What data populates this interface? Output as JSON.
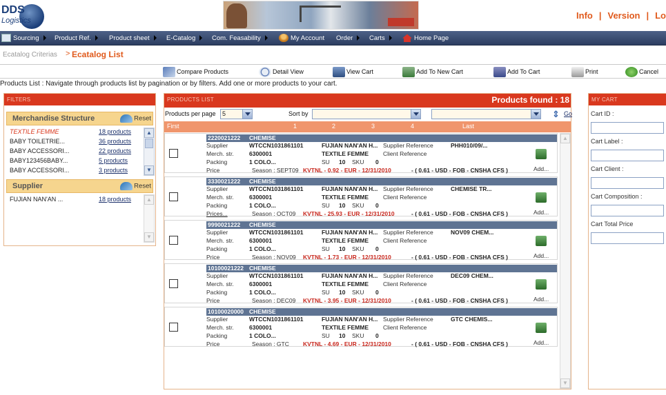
{
  "header": {
    "logo_text": "DDS",
    "logo_sub": "Logistics",
    "links": [
      "Info",
      "Version",
      "Lo"
    ],
    "separator": "|"
  },
  "menu": [
    {
      "label": "Sourcing",
      "icon": "sourcing-icon"
    },
    {
      "label": "Product Ref."
    },
    {
      "label": "Product sheet"
    },
    {
      "label": "E-Catalog"
    },
    {
      "label": "Com. Feasability"
    },
    {
      "label": "My Account",
      "icon": "user-icon"
    },
    {
      "label": "Order"
    },
    {
      "label": "Carts"
    },
    {
      "label": "Home Page",
      "icon": "home-icon"
    }
  ],
  "breadcrumb": {
    "previous": "Ecatalog Criterias",
    "separator": ">",
    "current": "Ecatalog List"
  },
  "toolbar": [
    {
      "label": "Compare Products",
      "icon": "compare-icon"
    },
    {
      "label": "Detail View",
      "icon": "detail-view-icon"
    },
    {
      "label": "View Cart",
      "icon": "view-cart-icon"
    },
    {
      "label": "Add To New Cart",
      "icon": "add-new-cart-icon"
    },
    {
      "label": "Add To Cart",
      "icon": "add-cart-icon"
    },
    {
      "label": "Print",
      "icon": "print-icon"
    },
    {
      "label": "Cancel",
      "icon": "cancel-icon"
    }
  ],
  "info_text": "Products List : Navigate through products list by pagination or by filters. Add one or more products to your cart.",
  "filters": {
    "title": "FILTERS",
    "reset_label": "Reset",
    "merch": {
      "title": "Merchandise Structure",
      "items": [
        {
          "name": "TEXTILE FEMME",
          "count": "18 products",
          "active": true
        },
        {
          "name": "BABY TOILETRIE...",
          "count": "36 products"
        },
        {
          "name": "BABY ACCESSORI...",
          "count": "22 products"
        },
        {
          "name": "BABY123456BABY...",
          "count": "5 products"
        },
        {
          "name": "BABY ACCESSORI...",
          "count": "3 products"
        }
      ]
    },
    "supplier": {
      "title": "Supplier",
      "items": [
        {
          "name": "FUJIAN NAN'AN ...",
          "count": "18 products"
        }
      ]
    }
  },
  "products": {
    "title": "PRODUCTS LIST",
    "found": "Products found : 18",
    "per_page_label": "Products per page",
    "per_page_value": "5",
    "sort_label": "Sort by",
    "sort_value": "",
    "sort_value2": "",
    "go_label": "Go",
    "pager": {
      "first": "First",
      "pages": [
        "1",
        "2",
        "3",
        "4"
      ],
      "last": "Last"
    },
    "labels": {
      "supplier": "Supplier",
      "merch": "Merch. str.",
      "packing": "Packing",
      "price": "Price",
      "supplier_ref": "Supplier Reference",
      "client_ref": "Client Reference",
      "su": "SU",
      "sku": "SKU",
      "add": "Add..."
    },
    "items": [
      {
        "code": "2220021222",
        "name": "CHEMISE",
        "supplier_code": "WTCCN1031861101",
        "supplier_name": "FUJIAN NAN'AN H...",
        "supplier_ref": "PHH010/09/...",
        "merch_code": "6300001",
        "merch_name": "TEXTILE FEMME",
        "packing": "1 COLO...",
        "su": "10",
        "sku": "0",
        "price_label": "Price",
        "season": "Season : SEPT09",
        "price_eur": "KVTNL - 0.92 - EUR - 12/31/2010",
        "price_usd": "- ( 0.61 - USD - FOB - CNSHA CFS )"
      },
      {
        "code": "3330021222",
        "name": "CHEMISE",
        "supplier_code": "WTCCN1031861101",
        "supplier_name": "FUJIAN NAN'AN H...",
        "supplier_ref": "CHEMISE TR...",
        "merch_code": "6300001",
        "merch_name": "TEXTILE FEMME",
        "packing": "1 COLO...",
        "su": "10",
        "sku": "0",
        "price_label": "Prices...",
        "season": "Season : OCT09",
        "price_eur": "KVTNL - 25.93 - EUR - 12/31/2010",
        "price_usd": "- ( 0.61 - USD - FOB - CNSHA CFS )"
      },
      {
        "code": "9990021222",
        "name": "CHEMISE",
        "supplier_code": "WTCCN1031861101",
        "supplier_name": "FUJIAN NAN'AN H...",
        "supplier_ref": "NOV09 CHEM...",
        "merch_code": "6300001",
        "merch_name": "TEXTILE FEMME",
        "packing": "1 COLO...",
        "su": "10",
        "sku": "0",
        "price_label": "Price",
        "season": "Season : NOV09",
        "price_eur": "KVTNL - 1.73 - EUR - 12/31/2010",
        "price_usd": "- ( 0.61 - USD - FOB - CNSHA CFS )"
      },
      {
        "code": "10100021222",
        "name": "CHEMISE",
        "supplier_code": "WTCCN1031861101",
        "supplier_name": "FUJIAN NAN'AN H...",
        "supplier_ref": "DEC09 CHEM...",
        "merch_code": "6300001",
        "merch_name": "TEXTILE FEMME",
        "packing": "1 COLO...",
        "su": "10",
        "sku": "0",
        "price_label": "Price",
        "season": "Season : DEC09",
        "price_eur": "KVTNL - 3.95 - EUR - 12/31/2010",
        "price_usd": "- ( 0.61 - USD - FOB - CNSHA CFS )"
      },
      {
        "code": "10100020000",
        "name": "CHEMISE",
        "supplier_code": "WTCCN1031861101",
        "supplier_name": "FUJIAN NAN'AN H...",
        "supplier_ref": "GTC CHEMIS...",
        "merch_code": "6300001",
        "merch_name": "TEXTILE FEMME",
        "packing": "1 COLO...",
        "su": "10",
        "sku": "0",
        "price_label": "Price",
        "season": "Season : GTC",
        "price_eur": "KVTNL - 4.69 - EUR - 12/31/2010",
        "price_usd": "- ( 0.61 - USD - FOB - CNSHA CFS )"
      }
    ]
  },
  "cart": {
    "title": "MY CART",
    "fields": [
      {
        "label": "Cart ID :",
        "value": ""
      },
      {
        "label": "Cart Label :",
        "value": ""
      },
      {
        "label": "Cart Client :",
        "value": ""
      },
      {
        "label": "Cart Composition :",
        "value": ""
      },
      {
        "label": "Cart Total Price",
        "value": ""
      }
    ]
  },
  "colors": {
    "accent": "#e05a1c",
    "panel_header": "#d9381e",
    "menu_bg": "#2c3d60",
    "section_bg": "#f6d58e",
    "price_red": "#c8281e"
  }
}
